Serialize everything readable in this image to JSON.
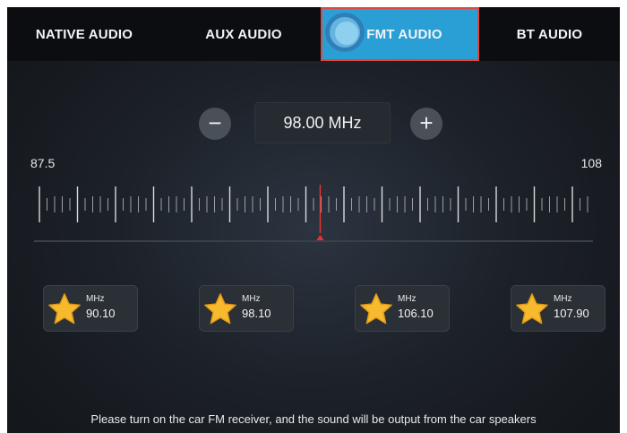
{
  "tabs": [
    {
      "label": "NATIVE AUDIO",
      "active": false
    },
    {
      "label": "AUX AUDIO",
      "active": false
    },
    {
      "label": "FMT AUDIO",
      "active": true
    },
    {
      "label": "BT AUDIO",
      "active": false
    }
  ],
  "tuner": {
    "frequency": "98.00 MHz",
    "min_label": "87.5",
    "max_label": "108",
    "minus_symbol": "−",
    "plus_symbol": "+"
  },
  "presets": [
    {
      "unit": "MHz",
      "value": "90.10",
      "icon": "star-icon"
    },
    {
      "unit": "MHz",
      "value": "98.10",
      "icon": "star-icon"
    },
    {
      "unit": "MHz",
      "value": "106.10",
      "icon": "star-icon"
    },
    {
      "unit": "MHz",
      "value": "107.90",
      "icon": "star-icon"
    }
  ],
  "footer_text": "Please turn on the car FM receiver, and the sound will be output from the car speakers",
  "colors": {
    "active_tab": "#2a9fd6",
    "highlight_border": "#e0473f",
    "indicator": "#e8322c",
    "star": "#f7b92e"
  }
}
